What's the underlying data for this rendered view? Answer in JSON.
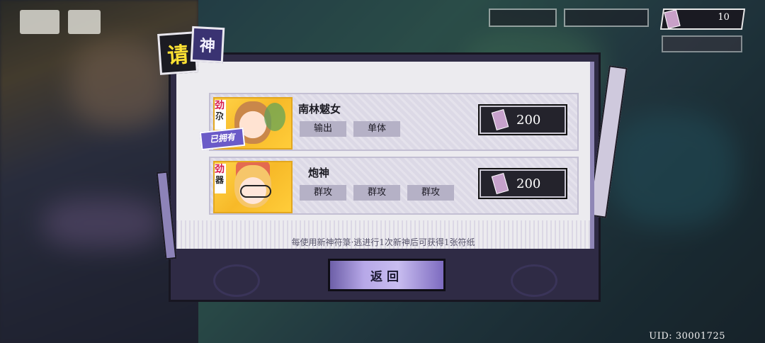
{
  "hud": {
    "currency_value": "10",
    "uid_text": "UID: 30001725"
  },
  "dialog": {
    "title_char1": "请",
    "title_char2": "神",
    "footer_note": "每使用新神符箓·逃进行1次新神后可获得1张符纸",
    "back_label": "返回",
    "items": [
      {
        "name": "南林魃女",
        "rarity_top": "劲",
        "rarity_bottom": "尕",
        "owned_label": "已拥有",
        "tags": [
          "输出",
          "单体"
        ],
        "price": "200"
      },
      {
        "name": "炮神",
        "rarity_top": "劲",
        "rarity_bottom": "器",
        "tags": [
          "群攻",
          "群攻",
          "群攻"
        ],
        "price": "200"
      }
    ]
  },
  "colors": {
    "accent_yellow": "#ffe233",
    "accent_purple": "#3a3372",
    "dialog_bg": "#2f2b45",
    "price_bg": "#24232c"
  },
  "icons": [
    "back-arrow-icon",
    "home-icon",
    "ticket-icon"
  ]
}
